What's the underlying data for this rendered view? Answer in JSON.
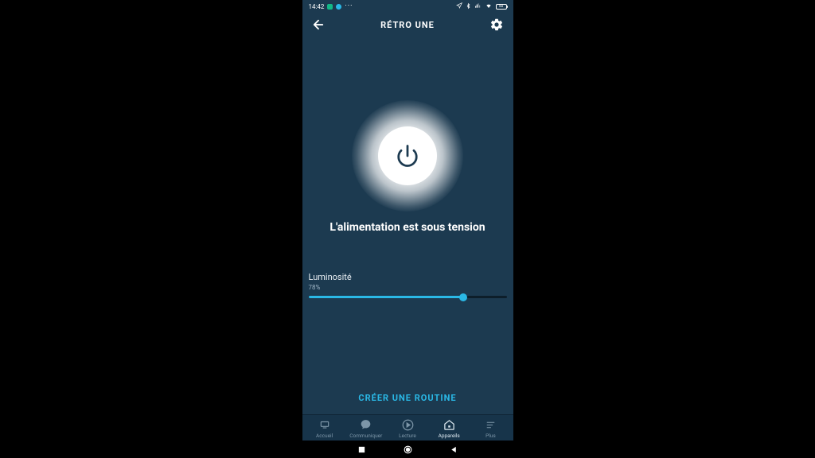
{
  "status": {
    "time": "14:42",
    "battery": "50"
  },
  "header": {
    "title": "RÉTRO UNE"
  },
  "power": {
    "status_text": "L'alimentation est sous tension"
  },
  "brightness": {
    "label": "Luminosité",
    "percent": 78,
    "percent_text": "78%"
  },
  "routine": {
    "link_label": "CRÉER UNE ROUTINE"
  },
  "nav": {
    "items": [
      {
        "label": "Accueil"
      },
      {
        "label": "Communiquer"
      },
      {
        "label": "Lecture"
      },
      {
        "label": "Appareils"
      },
      {
        "label": "Plus"
      }
    ]
  }
}
